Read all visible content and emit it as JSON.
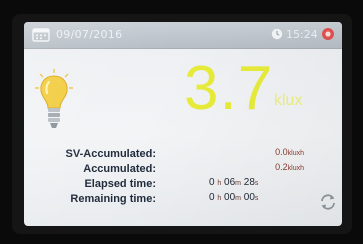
{
  "status_bar": {
    "date": "09/07/2016",
    "time": "15:24",
    "calendar_icon": "calendar-icon",
    "clock_icon": "clock-icon",
    "record_icon": "record-stop-icon"
  },
  "reading": {
    "value": "3.7",
    "unit": "klux",
    "bulb_icon": "light-bulb-icon"
  },
  "stats": {
    "sv_accumulated": {
      "label": "SV-Accumulated:",
      "value": "0.0",
      "unit": "kluxh"
    },
    "accumulated": {
      "label": "Accumulated:",
      "value": "0.2",
      "unit": "kluxh"
    },
    "elapsed": {
      "label": "Elapsed time:",
      "h": "0",
      "h_unit": "h",
      "m": "06",
      "m_unit": "m",
      "s": "28",
      "s_unit": "s"
    },
    "remaining": {
      "label": "Remaining time:",
      "h": "0",
      "h_unit": "h",
      "m": "00",
      "m_unit": "m",
      "s": "00",
      "s_unit": "s"
    }
  },
  "controls": {
    "refresh_icon": "refresh-icon"
  },
  "colors": {
    "reading": "#e7ec3a",
    "labels": "#1f2a3a",
    "values": "#8a3a2e",
    "topbar": "#b7bec5"
  }
}
